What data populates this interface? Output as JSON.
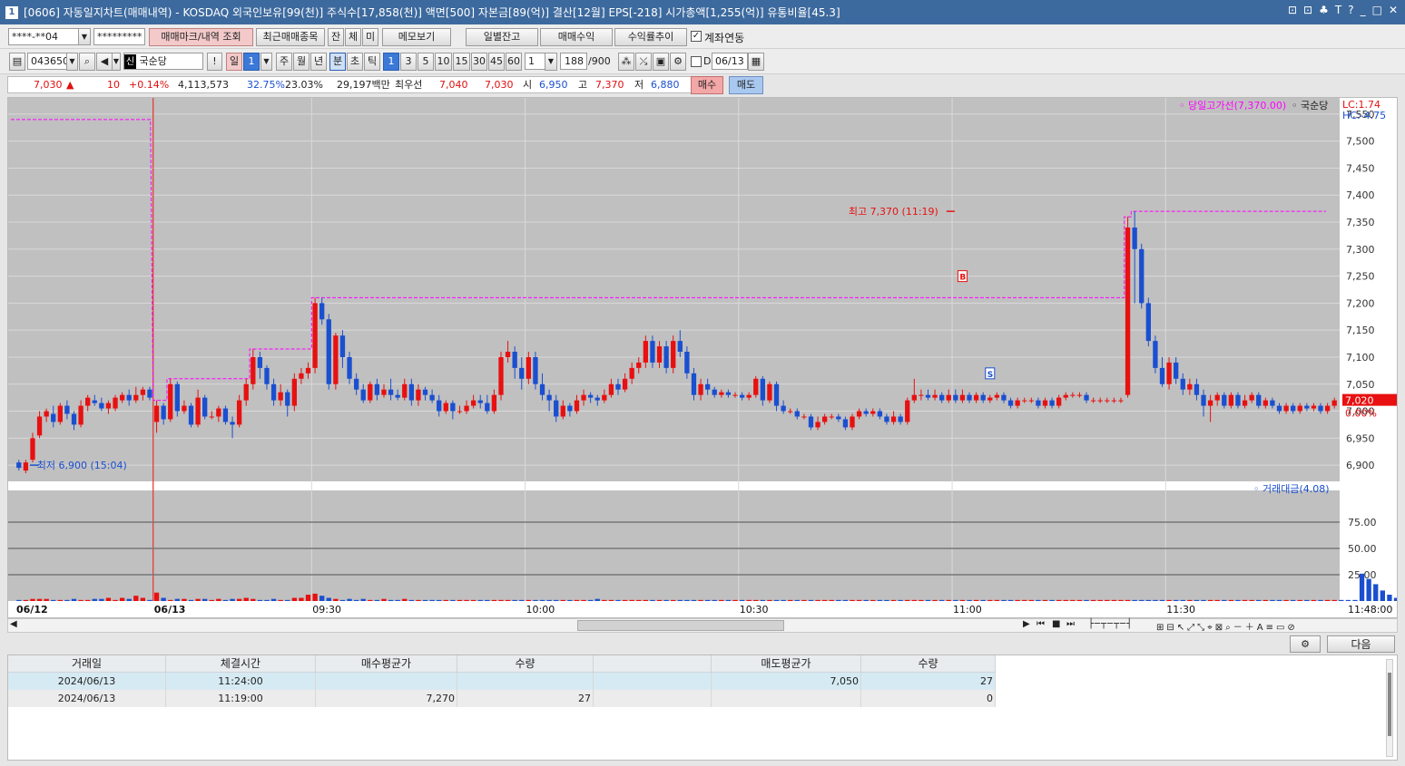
{
  "window": {
    "number": "1",
    "title": "[0606] 자동일지차트(매매내역) - KOSDAQ 외국인보유[99(천)] 주식수[17,858(천)] 액면[500] 자본금[89(억)] 결산[12월] EPS[-218] 시가총액[1,255(억)] 유통비율[45.3]",
    "controls": [
      "⊡",
      "⊡",
      "♣",
      "T",
      "?",
      "_",
      "□",
      "✕"
    ]
  },
  "toolbar1": {
    "account": "****-**04",
    "password": "*********",
    "buttons": [
      "매매마크/내역 조회",
      "최근매매종목",
      "잔",
      "체",
      "미",
      "메모보기",
      "일별잔고",
      "매매수익",
      "수익률추이"
    ],
    "link_label": "계좌연동"
  },
  "toolbar2": {
    "code": "043650",
    "name_prefix": "신",
    "name": "국순당",
    "period_day": "일",
    "period_value": "1",
    "periods": [
      "주",
      "월",
      "년",
      "분",
      "초",
      "틱"
    ],
    "minute_options": [
      "1",
      "3",
      "5",
      "10",
      "15",
      "30",
      "45",
      "60"
    ],
    "interval": "1",
    "count": "188",
    "count_max": "/900",
    "d_label": "D",
    "date": "06/13"
  },
  "quote": {
    "price": "7,030",
    "arrow": "▲",
    "change": "10",
    "change_pct": "+0.14%",
    "volume": "4,113,573",
    "pct1": "32.75%",
    "pct2": "23.03%",
    "amount": "29,197백만",
    "best_label": "최우선",
    "ask": "7,040",
    "bid": "7,030",
    "open_label": "시",
    "open": "6,950",
    "high_label": "고",
    "high": "7,370",
    "low_label": "저",
    "low": "6,880",
    "buy": "매수",
    "sell": "매도"
  },
  "colors": {
    "up": "#e81010",
    "down": "#1a4fd0",
    "bg": "#c0c0c0",
    "grid": "#d9d9d9",
    "hi": "#ff00ff"
  },
  "chart_data": {
    "type": "candlestick",
    "title": "",
    "y_ticks": [
      "7,550",
      "7,500",
      "7,450",
      "7,400",
      "7,350",
      "7,300",
      "7,250",
      "7,200",
      "7,150",
      "7,100",
      "7,050",
      "7,000",
      "6,950",
      "6,900"
    ],
    "ylim": [
      6870,
      7580
    ],
    "x_labels": [
      "06/12",
      "06/13",
      "09:30",
      "10:00",
      "10:30",
      "11:00",
      "11:30",
      "11:48:00"
    ],
    "legend_high": "당일고가선(7,370.00)",
    "legend_name": "국순당",
    "lc": "LC:1.74",
    "hc": "HC:-4.75",
    "current_price": "7,020",
    "current_pct": "0.00%",
    "high_annot": "최고 7,370 (11:19)",
    "low_annot": "최저 6,900 (15:04)",
    "buy_mark": "B",
    "sell_mark": "S",
    "volume_legend": "거래대금(4.08)",
    "volume_ticks": [
      "75.00",
      "50.00",
      "25.00"
    ],
    "candles": [
      [
        6905,
        6895,
        6910,
        6890
      ],
      [
        6890,
        6905,
        6910,
        6885
      ],
      [
        6910,
        6950,
        6960,
        6905
      ],
      [
        6955,
        6990,
        7000,
        6950
      ],
      [
        6990,
        7000,
        7005,
        6980
      ],
      [
        6995,
        6980,
        7010,
        6970
      ],
      [
        6980,
        7010,
        7015,
        6975
      ],
      [
        7010,
        6995,
        7020,
        6985
      ],
      [
        6995,
        6975,
        7000,
        6965
      ],
      [
        6975,
        7010,
        7020,
        6970
      ],
      [
        7010,
        7025,
        7030,
        7000
      ],
      [
        7020,
        7015,
        7030,
        7010
      ],
      [
        7015,
        7005,
        7025,
        7000
      ],
      [
        7005,
        7015,
        7020,
        6995
      ],
      [
        7005,
        7025,
        7030,
        7000
      ],
      [
        7020,
        7030,
        7035,
        7015
      ],
      [
        7030,
        7020,
        7040,
        7010
      ],
      [
        7020,
        7030,
        7045,
        7015
      ],
      [
        7030,
        7040,
        7045,
        7020
      ],
      [
        7040,
        7025,
        7045,
        7020
      ],
      [
        6980,
        7010,
        7020,
        6960
      ],
      [
        7010,
        6985,
        7015,
        6975
      ],
      [
        6985,
        7050,
        7060,
        6980
      ],
      [
        7050,
        7000,
        7055,
        6990
      ],
      [
        7000,
        7010,
        7020,
        6995
      ],
      [
        7010,
        6975,
        7015,
        6970
      ],
      [
        6975,
        7025,
        7040,
        6970
      ],
      [
        7025,
        6990,
        7030,
        6985
      ],
      [
        6990,
        6990,
        7000,
        6985
      ],
      [
        6990,
        7005,
        7010,
        6980
      ],
      [
        7005,
        6980,
        7010,
        6975
      ],
      [
        6980,
        6975,
        6990,
        6950
      ],
      [
        6975,
        7020,
        7030,
        6970
      ],
      [
        7020,
        7050,
        7060,
        7010
      ],
      [
        7050,
        7100,
        7115,
        7040
      ],
      [
        7100,
        7080,
        7110,
        7060
      ],
      [
        7080,
        7050,
        7085,
        7040
      ],
      [
        7050,
        7020,
        7060,
        7010
      ],
      [
        7020,
        7035,
        7050,
        7010
      ],
      [
        7035,
        7010,
        7040,
        6990
      ],
      [
        7010,
        7060,
        7070,
        7000
      ],
      [
        7060,
        7070,
        7080,
        7050
      ],
      [
        7070,
        7080,
        7090,
        7060
      ],
      [
        7080,
        7200,
        7210,
        7070
      ],
      [
        7200,
        7170,
        7210,
        7160
      ],
      [
        7170,
        7050,
        7180,
        7040
      ],
      [
        7050,
        7140,
        7145,
        7040
      ],
      [
        7140,
        7100,
        7150,
        7080
      ],
      [
        7100,
        7060,
        7110,
        7050
      ],
      [
        7060,
        7040,
        7070,
        7030
      ],
      [
        7040,
        7020,
        7050,
        7015
      ],
      [
        7020,
        7050,
        7055,
        7015
      ],
      [
        7050,
        7030,
        7060,
        7020
      ],
      [
        7030,
        7040,
        7050,
        7025
      ],
      [
        7040,
        7030,
        7060,
        7020
      ],
      [
        7030,
        7025,
        7040,
        7020
      ],
      [
        7025,
        7050,
        7060,
        7020
      ],
      [
        7050,
        7020,
        7060,
        7010
      ],
      [
        7020,
        7040,
        7050,
        7010
      ],
      [
        7040,
        7030,
        7045,
        7020
      ],
      [
        7030,
        7020,
        7040,
        7015
      ],
      [
        7020,
        7000,
        7030,
        6990
      ],
      [
        7000,
        7015,
        7020,
        6995
      ],
      [
        7015,
        7000,
        7020,
        6985
      ],
      [
        7000,
        7000,
        7010,
        6995
      ],
      [
        7000,
        7010,
        7020,
        6995
      ],
      [
        7010,
        7020,
        7030,
        7005
      ],
      [
        7020,
        7015,
        7030,
        7005
      ],
      [
        7015,
        7000,
        7030,
        6995
      ],
      [
        7000,
        7030,
        7040,
        6995
      ],
      [
        7030,
        7100,
        7110,
        7020
      ],
      [
        7100,
        7110,
        7130,
        7090
      ],
      [
        7110,
        7080,
        7120,
        7060
      ],
      [
        7080,
        7060,
        7100,
        7040
      ],
      [
        7060,
        7100,
        7110,
        7050
      ],
      [
        7100,
        7050,
        7110,
        7040
      ],
      [
        7050,
        7030,
        7070,
        7020
      ],
      [
        7030,
        7020,
        7040,
        7000
      ],
      [
        7020,
        6990,
        7030,
        6980
      ],
      [
        6990,
        7010,
        7020,
        6985
      ],
      [
        7010,
        7000,
        7015,
        6990
      ],
      [
        7000,
        7020,
        7030,
        6995
      ],
      [
        7020,
        7030,
        7040,
        7010
      ],
      [
        7030,
        7025,
        7035,
        7015
      ],
      [
        7025,
        7020,
        7030,
        7010
      ],
      [
        7020,
        7030,
        7040,
        7015
      ],
      [
        7030,
        7050,
        7060,
        7025
      ],
      [
        7050,
        7040,
        7060,
        7030
      ],
      [
        7040,
        7060,
        7070,
        7035
      ],
      [
        7060,
        7080,
        7090,
        7050
      ],
      [
        7080,
        7090,
        7100,
        7070
      ],
      [
        7090,
        7130,
        7140,
        7080
      ],
      [
        7130,
        7090,
        7140,
        7080
      ],
      [
        7090,
        7120,
        7130,
        7080
      ],
      [
        7120,
        7080,
        7130,
        7070
      ],
      [
        7080,
        7130,
        7140,
        7070
      ],
      [
        7130,
        7110,
        7150,
        7100
      ],
      [
        7110,
        7070,
        7120,
        7060
      ],
      [
        7070,
        7030,
        7080,
        7020
      ],
      [
        7030,
        7050,
        7060,
        7020
      ],
      [
        7050,
        7040,
        7060,
        7030
      ],
      [
        7040,
        7030,
        7045,
        7025
      ],
      [
        7030,
        7035,
        7040,
        7025
      ],
      [
        7035,
        7030,
        7040,
        7025
      ],
      [
        7030,
        7030,
        7035,
        7025
      ],
      [
        7030,
        7025,
        7035,
        7020
      ],
      [
        7025,
        7030,
        7035,
        7020
      ],
      [
        7030,
        7060,
        7065,
        7025
      ],
      [
        7060,
        7020,
        7065,
        7010
      ],
      [
        7020,
        7050,
        7055,
        7015
      ],
      [
        7050,
        7010,
        7055,
        7000
      ],
      [
        7010,
        7000,
        7020,
        6995
      ],
      [
        7000,
        7000,
        7005,
        6995
      ],
      [
        7000,
        6990,
        7005,
        6985
      ],
      [
        6990,
        6990,
        6995,
        6985
      ],
      [
        6990,
        6970,
        6995,
        6965
      ],
      [
        6970,
        6980,
        6990,
        6965
      ],
      [
        6980,
        6990,
        6995,
        6975
      ],
      [
        6990,
        6990,
        6995,
        6985
      ],
      [
        6990,
        6985,
        6995,
        6980
      ],
      [
        6985,
        6970,
        6990,
        6965
      ],
      [
        6970,
        6990,
        6995,
        6965
      ],
      [
        6990,
        7000,
        7005,
        6985
      ],
      [
        7000,
        6995,
        7005,
        6990
      ],
      [
        6995,
        7000,
        7005,
        6990
      ],
      [
        7000,
        6990,
        7005,
        6985
      ],
      [
        6990,
        6980,
        6995,
        6975
      ],
      [
        6980,
        6990,
        7000,
        6975
      ],
      [
        6990,
        6980,
        6995,
        6975
      ],
      [
        6980,
        7020,
        7025,
        6975
      ],
      [
        7020,
        7030,
        7060,
        7015
      ],
      [
        7030,
        7030,
        7040,
        7020
      ],
      [
        7030,
        7025,
        7040,
        7020
      ],
      [
        7025,
        7030,
        7040,
        7020
      ],
      [
        7030,
        7020,
        7035,
        7015
      ],
      [
        7020,
        7030,
        7040,
        7015
      ],
      [
        7030,
        7020,
        7040,
        7015
      ],
      [
        7020,
        7030,
        7040,
        7015
      ],
      [
        7030,
        7020,
        7035,
        7015
      ],
      [
        7020,
        7030,
        7035,
        7015
      ],
      [
        7030,
        7020,
        7035,
        7015
      ],
      [
        7020,
        7025,
        7030,
        7015
      ],
      [
        7025,
        7030,
        7035,
        7020
      ],
      [
        7030,
        7020,
        7035,
        7015
      ],
      [
        7020,
        7010,
        7025,
        7005
      ],
      [
        7010,
        7020,
        7025,
        7005
      ],
      [
        7020,
        7020,
        7025,
        7015
      ],
      [
        7020,
        7020,
        7025,
        7015
      ],
      [
        7020,
        7010,
        7025,
        7005
      ],
      [
        7010,
        7020,
        7025,
        7005
      ],
      [
        7020,
        7010,
        7025,
        7005
      ],
      [
        7010,
        7025,
        7030,
        7005
      ],
      [
        7025,
        7030,
        7035,
        7020
      ],
      [
        7030,
        7030,
        7035,
        7025
      ],
      [
        7030,
        7030,
        7035,
        7025
      ],
      [
        7030,
        7020,
        7035,
        7015
      ],
      [
        7020,
        7020,
        7025,
        7015
      ],
      [
        7020,
        7020,
        7025,
        7015
      ],
      [
        7020,
        7020,
        7025,
        7015
      ],
      [
        7020,
        7020,
        7025,
        7015
      ],
      [
        7020,
        7020,
        7025,
        7015
      ],
      [
        7030,
        7340,
        7360,
        7025
      ],
      [
        7340,
        7300,
        7370,
        7200
      ],
      [
        7300,
        7200,
        7310,
        7190
      ],
      [
        7200,
        7130,
        7210,
        7120
      ],
      [
        7130,
        7080,
        7140,
        7070
      ],
      [
        7080,
        7050,
        7100,
        7045
      ],
      [
        7050,
        7090,
        7100,
        7040
      ],
      [
        7090,
        7060,
        7100,
        7050
      ],
      [
        7060,
        7040,
        7070,
        7030
      ],
      [
        7040,
        7050,
        7060,
        7030
      ],
      [
        7050,
        7030,
        7060,
        7020
      ],
      [
        7030,
        7010,
        7040,
        6990
      ],
      [
        7010,
        7020,
        7030,
        6980
      ],
      [
        7020,
        7030,
        7035,
        7010
      ],
      [
        7030,
        7010,
        7035,
        7005
      ],
      [
        7010,
        7030,
        7035,
        7005
      ],
      [
        7030,
        7010,
        7035,
        7005
      ],
      [
        7010,
        7020,
        7030,
        7005
      ],
      [
        7020,
        7030,
        7035,
        7015
      ],
      [
        7030,
        7010,
        7035,
        7005
      ],
      [
        7010,
        7020,
        7025,
        7005
      ],
      [
        7020,
        7010,
        7025,
        7005
      ],
      [
        7010,
        7000,
        7015,
        6995
      ],
      [
        7000,
        7010,
        7015,
        6995
      ],
      [
        7010,
        7000,
        7015,
        6995
      ],
      [
        7000,
        7010,
        7015,
        6995
      ],
      [
        7010,
        7005,
        7015,
        7000
      ],
      [
        7005,
        7010,
        7015,
        7000
      ],
      [
        7010,
        7000,
        7015,
        6995
      ],
      [
        7000,
        7010,
        7015,
        6995
      ],
      [
        7010,
        7020,
        7025,
        7005
      ]
    ],
    "volumes_pct": [
      1,
      1,
      2,
      2,
      2,
      1,
      1,
      1,
      2,
      1,
      1,
      2,
      2,
      3,
      1,
      3,
      2,
      5,
      3,
      1,
      8,
      3,
      1,
      2,
      2,
      1,
      2,
      2,
      1,
      2,
      1,
      2,
      2,
      3,
      2,
      1,
      1,
      2,
      1,
      1,
      3,
      3,
      6,
      7,
      5,
      3,
      2,
      1,
      2,
      1,
      2,
      1,
      1,
      2,
      1,
      1,
      2,
      1,
      1,
      1,
      1,
      1,
      1,
      1,
      1,
      1,
      1,
      1,
      1,
      1,
      1,
      1,
      1,
      1,
      1,
      1,
      1,
      1,
      1,
      1,
      1,
      1,
      1,
      1,
      2,
      1,
      1,
      1,
      1,
      1,
      1,
      1,
      1,
      1,
      1,
      1,
      1,
      1,
      1,
      1,
      1,
      1,
      1,
      1,
      1,
      1,
      1,
      1,
      1,
      1,
      1,
      1,
      1,
      1,
      1,
      1,
      1,
      1,
      1,
      1,
      1,
      1,
      1,
      1,
      1,
      1,
      1,
      1,
      1,
      1,
      1,
      1,
      1,
      1,
      1,
      1,
      1,
      1,
      1,
      1,
      1,
      1,
      1,
      1,
      1,
      1,
      1,
      1,
      1,
      1,
      1,
      1,
      1,
      1,
      1,
      1,
      1,
      1,
      1,
      1,
      1,
      1,
      1,
      1,
      1,
      1,
      1,
      1,
      1,
      1,
      1,
      1,
      1,
      1,
      1,
      1,
      1,
      1,
      1,
      1,
      1,
      1,
      1,
      1,
      1,
      1,
      1,
      1,
      1,
      1,
      1,
      1,
      1,
      1,
      1,
      26,
      21,
      16,
      10,
      6,
      3,
      2,
      2,
      2,
      2,
      3,
      4,
      2,
      1,
      1,
      1,
      1,
      1,
      1,
      1,
      1,
      1,
      1,
      1,
      1,
      1,
      1,
      1,
      1,
      1,
      1,
      1
    ]
  },
  "table": {
    "headers": [
      "거래일",
      "체결시간",
      "매수평균가",
      "수량",
      "",
      "매도평균가",
      "수량"
    ],
    "rows": [
      [
        "2024/06/13",
        "11:24:00",
        "",
        "",
        "",
        "7,050",
        "27"
      ],
      [
        "2024/06/13",
        "11:19:00",
        "7,270",
        "27",
        "",
        "",
        "0"
      ]
    ],
    "next_label": "다음"
  }
}
